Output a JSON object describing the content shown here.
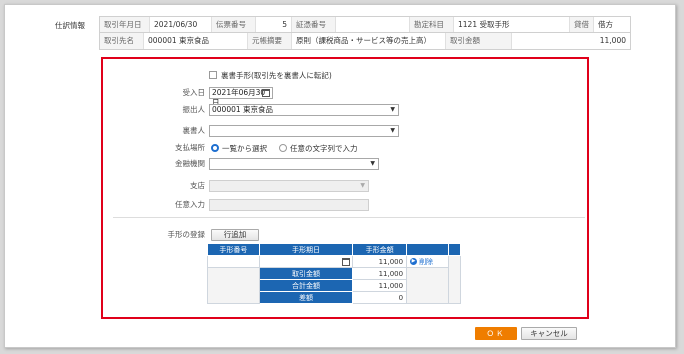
{
  "journal": {
    "title": "仕訳情報",
    "row1": [
      {
        "label": "取引年月日",
        "value": "2021/06/30"
      },
      {
        "label": "伝票番号",
        "value": "5"
      },
      {
        "label": "証憑番号",
        "value": ""
      },
      {
        "label": "勘定科目",
        "value": "1121 受取手形"
      },
      {
        "label": "貸借",
        "value": "借方"
      }
    ],
    "row2": [
      {
        "label": "取引先名",
        "value": "000001 東京食品"
      },
      {
        "label": "元帳摘要",
        "value": "原則（課税商品・サービス等の売上高）"
      },
      {
        "label": "取引金額",
        "value": "11,000"
      }
    ]
  },
  "form": {
    "endorse_checkbox_label": "裏書手形(取引先を裏書人に転記)",
    "received_date_label": "受入日",
    "received_date_value": "2021年06月30日",
    "drawer_label": "振出人",
    "drawer_value": "000001 東京食品",
    "endorser_label": "裏書人",
    "endorser_value": "",
    "payment_place_label": "支払場所",
    "radio_select_label": "一覧から選択",
    "radio_text_label": "任意の文字列で入力",
    "bank_label": "金融機関",
    "bank_value": "",
    "branch_label": "支店",
    "branch_value": "",
    "free_input_label": "任意入力",
    "free_input_value": "",
    "note_register_label": "手形の登録",
    "add_row_button": "行追加"
  },
  "notes_table": {
    "headers": [
      "手形番号",
      "手形期日",
      "手形金額"
    ],
    "row": {
      "number": "",
      "due_date": "",
      "amount": "11,000",
      "delete_label": "削除"
    },
    "summary": [
      {
        "label": "取引金額",
        "value": "11,000"
      },
      {
        "label": "合計金額",
        "value": "11,000"
      },
      {
        "label": "差額",
        "value": "0"
      }
    ]
  },
  "footer": {
    "ok": "ＯＫ",
    "cancel": "キャンセル"
  },
  "colors": {
    "header_blue": "#1c66b2",
    "ok_orange": "#ef7d00",
    "highlight_red": "#e0001a",
    "radio_blue": "#1e6fd0"
  }
}
